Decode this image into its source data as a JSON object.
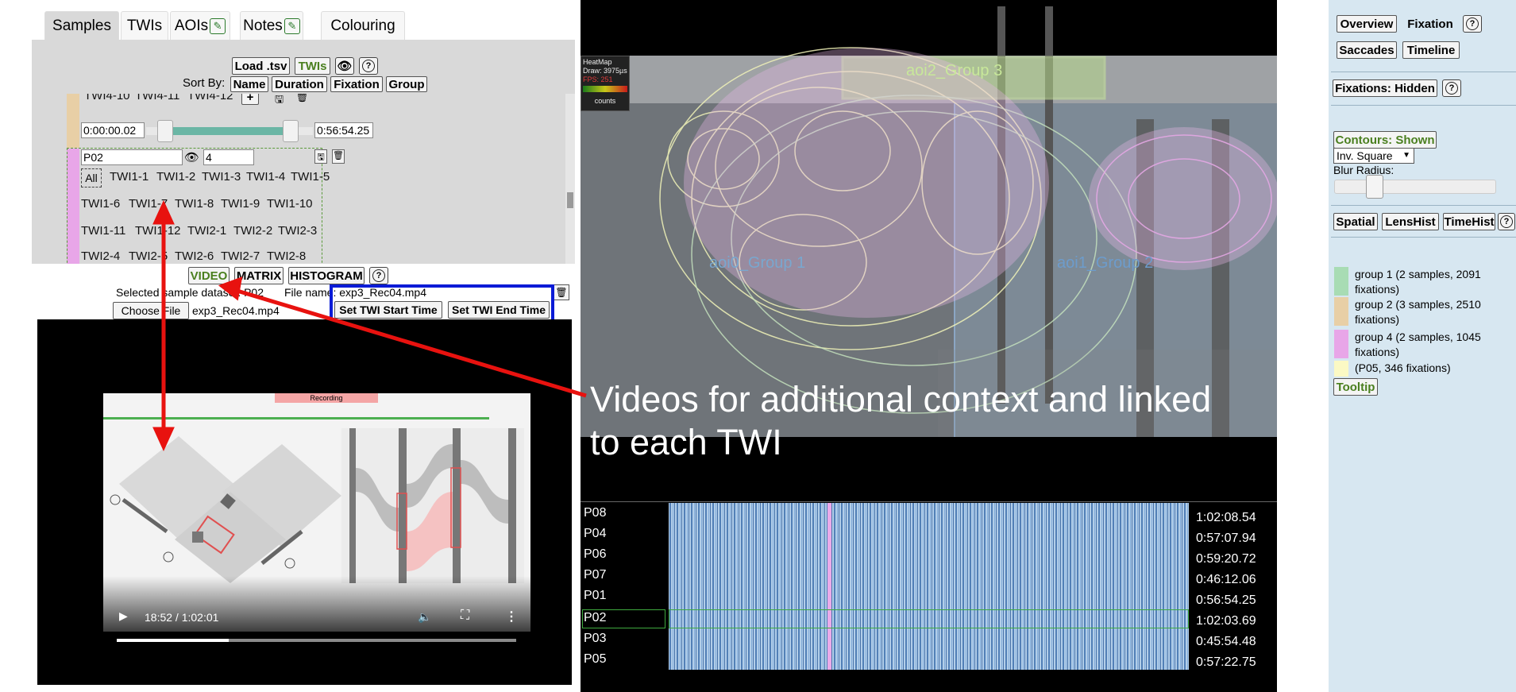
{
  "tabs": [
    {
      "label": "Samples"
    },
    {
      "label": "TWIs"
    },
    {
      "label": "AOIs"
    },
    {
      "label": "Notes"
    },
    {
      "label": "Colouring"
    }
  ],
  "samples_toolbar": {
    "load_label": "Load .tsv",
    "twis_label": "TWIs",
    "sort_by_label": "Sort By:",
    "sort_buttons": [
      "Name",
      "Duration",
      "Fixation",
      "Group"
    ]
  },
  "sample_list": {
    "top_row": [
      "TWI4-10",
      "TWI4-11",
      "TWI4-12"
    ],
    "start_time": "0:00:00.02",
    "end_time": "0:56:54.25",
    "sample_name": "P02",
    "group_value": "4",
    "all_label": "All",
    "twi_rows": [
      [
        "TWI1-1",
        "TWI1-2",
        "TWI1-3",
        "TWI1-4",
        "TWI1-5"
      ],
      [
        "TWI1-6",
        "TWI1-7",
        "TWI1-8",
        "TWI1-9",
        "TWI1-10"
      ],
      [
        "TWI1-11",
        "TWI1-12",
        "TWI2-1",
        "TWI2-2",
        "TWI2-3"
      ],
      [
        "TWI2-4",
        "TWI2-5",
        "TWI2-6",
        "TWI2-7",
        "TWI2-8"
      ]
    ]
  },
  "view_buttons": {
    "video": "VIDEO",
    "matrix": "MATRIX",
    "histogram": "HISTOGRAM"
  },
  "video_controls": {
    "selected_label": "Selected sample dataset: P02",
    "filename_label": "File name: exp3_Rec04.mp4",
    "choose_file_label": "Choose File",
    "chosen_file": "exp3_Rec04.mp4",
    "set_start_label": "Set TWI Start Time",
    "set_end_label": "Set TWI End Time"
  },
  "video_player": {
    "recording_label": "Recording",
    "time": "18:52 / 1:02:01",
    "progress": 0.28
  },
  "annotation": {
    "text_line1": "Videos for additional context and linked",
    "text_line2": "to each TWI"
  },
  "heatmap": {
    "info_title": "HeatMap",
    "info_draw": "Draw: 3975µs",
    "info_fps": "FPS: 251",
    "info_counts": "counts",
    "aoi_labels": [
      "aoi0_Group 1",
      "aoi1_Group 2",
      "aoi2_Group 3"
    ]
  },
  "timeline": {
    "rows": [
      {
        "name": "P08",
        "duration": "1:02:08.54"
      },
      {
        "name": "P04",
        "duration": "0:57:07.94"
      },
      {
        "name": "P06",
        "duration": "0:59:20.72"
      },
      {
        "name": "P07",
        "duration": "0:46:12.06"
      },
      {
        "name": "P01",
        "duration": "0:56:54.25"
      },
      {
        "name": "P02",
        "duration": "1:02:03.69"
      },
      {
        "name": "P03",
        "duration": "0:45:54.48"
      },
      {
        "name": "P05",
        "duration": "0:57:22.75"
      }
    ],
    "selected": "P02"
  },
  "sidebar": {
    "tab_overview": "Overview",
    "tab_fixation": "Fixation",
    "tab_saccades": "Saccades",
    "tab_timeline": "Timeline",
    "fixations_toggle": "Fixations: Hidden",
    "contours_toggle": "Contours: Shown",
    "kernel_select": "Inv. Square",
    "blur_label": "Blur Radius:",
    "blur_value": 0.25,
    "hist_buttons": [
      "Spatial",
      "LensHist",
      "TimeHist"
    ],
    "legend": [
      {
        "label": "group 1 (2 samples, 2091 fixations)",
        "color": "#a8dcb4"
      },
      {
        "label": "group 2 (3 samples, 2510 fixations)",
        "color": "#e8cfa6"
      },
      {
        "label": "group 4 (2 samples, 1045 fixations)",
        "color": "#e8a6e8"
      },
      {
        "label": "(P05, 346 fixations)",
        "color": "#fbf9c4"
      }
    ],
    "tooltip_label": "Tooltip"
  }
}
